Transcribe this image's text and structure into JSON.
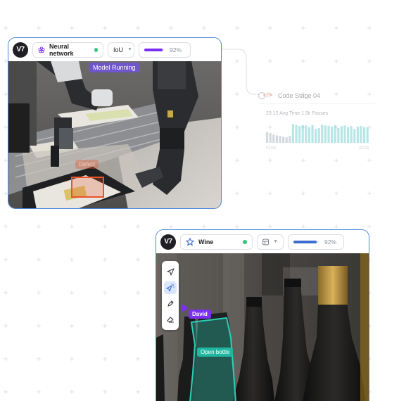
{
  "card_robot": {
    "brand": "V7",
    "dataset_name": "Neural network",
    "metric_select": "IoU",
    "progress": {
      "value": 0.92,
      "label": "92%",
      "color": "#7b2ff2"
    },
    "status_tag": "Model Running",
    "box_label": "Defect"
  },
  "code_stage": {
    "title": "Code Stage 04",
    "stats": "23:12 Avg Time  1.5k Passes",
    "axis_start": "01/11",
    "axis_end": "22/11",
    "bar_values": [
      0.55,
      0.5,
      0.42,
      0.38,
      0.35,
      0.3,
      0.28,
      0.35,
      0.95,
      0.9,
      0.85,
      0.9,
      0.88,
      0.8,
      0.9,
      0.7,
      0.75,
      0.92,
      0.88,
      0.85,
      0.82,
      0.9,
      0.75,
      0.85,
      0.88,
      0.8,
      0.85,
      0.7,
      0.82,
      0.86,
      0.8,
      0.78
    ],
    "colors": {
      "bar_gray": "#9aa3b5",
      "bar_teal": "#57c6c6",
      "icon": "#e8542b"
    }
  },
  "card_wine": {
    "brand": "V7",
    "dataset_name": "Wine",
    "progress": {
      "value": 0.92,
      "label": "92%",
      "color": "#3d6fd1"
    },
    "cursor_label": "David",
    "annotation_label": "Open bottle",
    "annotation_color": "#2ecdb5",
    "cursor_color": "#7b2ff2",
    "tools": [
      "navigate-icon",
      "auto-annotate-icon",
      "pen-icon",
      "eraser-icon"
    ]
  }
}
